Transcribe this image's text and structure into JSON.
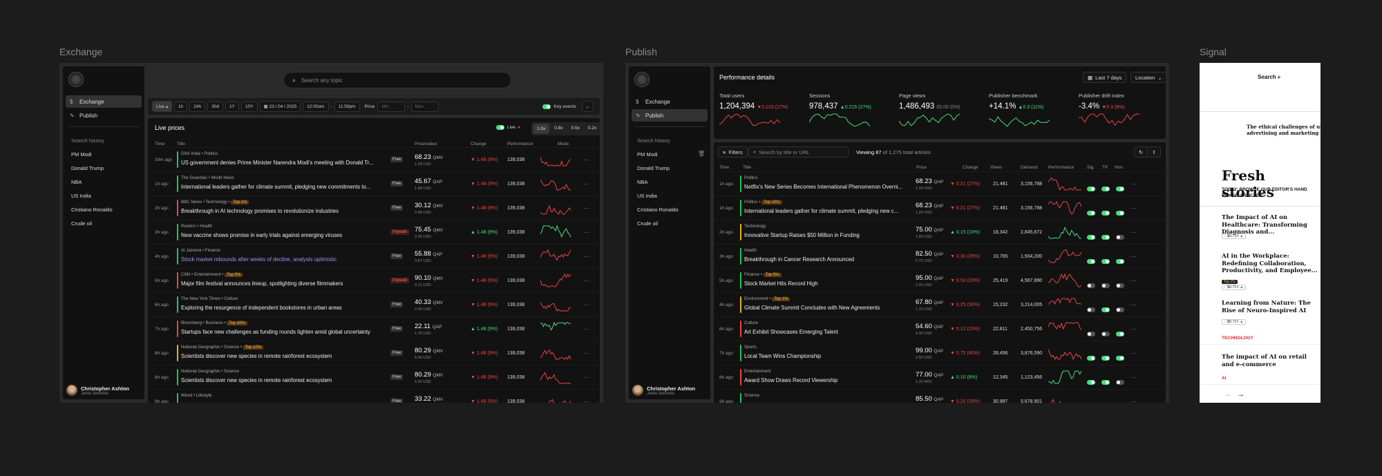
{
  "panels": {
    "exchange": "Exchange",
    "publish": "Publish",
    "signal": "Signal"
  },
  "sidebar": {
    "nav": [
      {
        "label": "Exchange",
        "icon": "dollar-icon"
      },
      {
        "label": "Publish",
        "icon": "pen-icon"
      }
    ],
    "history_title": "Search history",
    "history": [
      "PM Modi",
      "Donald Trump",
      "NBA",
      "US India",
      "Cristiano Ronaldo",
      "Crude oil"
    ],
    "user": {
      "name": "Christopher Ashton",
      "sub": "Janta Seriishta"
    }
  },
  "exchange": {
    "search_placeholder": "Search any topic",
    "toolbar": {
      "live": "Live",
      "ranges": [
        "1h",
        "24h",
        "30d",
        "1Y",
        "10Y"
      ],
      "date": "23 / 04 / 2025",
      "time_from": "12:00am",
      "time_to": "11:59pm",
      "price_label": "Price",
      "min_placeholder": "Min",
      "max_placeholder": "Max",
      "key_events": "Key events"
    },
    "title": "Live prices",
    "live_label": "Live",
    "speeds": [
      "1.0x",
      "0.8x",
      "0.5x",
      "0.2x"
    ],
    "columns": [
      "Time",
      "Title",
      "Price/value",
      "Change",
      "Performance",
      "Mode"
    ],
    "rows": [
      {
        "time": "30m ago",
        "source": "DNA India",
        "cat": "Politics",
        "tag": "",
        "title": "US government denies Prime Minister Narendra Modi's meeting with Donald Tr...",
        "badge": "Free",
        "price": "68.23",
        "unit": "QMV",
        "usd": "1.24 USD",
        "dir": "down",
        "change": "1.48 (9%)",
        "perf": "139,038",
        "bar": "#22c55e"
      },
      {
        "time": "1h ago",
        "source": "The Guardian",
        "cat": "World News",
        "tag": "",
        "title": "International leaders gather for climate summit, pledging new commitments to...",
        "badge": "Free",
        "price": "45.67",
        "unit": "QAP",
        "usd": "1.88 USD",
        "dir": "down",
        "change": "1.48 (9%)",
        "perf": "139,038",
        "bar": "#22c55e"
      },
      {
        "time": "2h ago",
        "source": "BBC News",
        "cat": "Technology",
        "tag": "Top 1%",
        "title": "Breakthrough in AI technology promises to revolutionize industries",
        "badge": "Free",
        "price": "30.12",
        "unit": "QMV",
        "usd": "0.89 USD",
        "dir": "down",
        "change": "1.48 (9%)",
        "perf": "139,038",
        "bar": "#ef4444"
      },
      {
        "time": "3h ago",
        "source": "Reuters",
        "cat": "Health",
        "tag": "",
        "title": "New vaccine shows promise in early trials against emerging viruses",
        "badge": "Paywall",
        "price": "75.45",
        "unit": "QMV",
        "usd": "2.34 USD",
        "dir": "up",
        "change": "1.48 (9%)",
        "perf": "139,038",
        "bar": "#22c55e"
      },
      {
        "time": "4h ago",
        "source": "Al Jazeera",
        "cat": "Finance",
        "tag": "",
        "title": "Stock market rebounds after weeks of decline, analysts optimistic",
        "badge": "Free",
        "price": "55.88",
        "unit": "QAP",
        "usd": "3.67 USD",
        "dir": "down",
        "change": "1.48 (9%)",
        "perf": "139,038",
        "bar": "#22c55e",
        "purple": true
      },
      {
        "time": "5h ago",
        "source": "CNN",
        "cat": "Entertainment",
        "tag": "Top 5%",
        "title": "Major film festival announces lineup, spotlighting diverse filmmakers",
        "badge": "Paywall",
        "price": "90.10",
        "unit": "QMV",
        "usd": "4.12 USD",
        "dir": "down",
        "change": "1.48 (9%)",
        "perf": "139,038",
        "bar": "#ef4444"
      },
      {
        "time": "6h ago",
        "source": "The New York Times",
        "cat": "Culture",
        "tag": "",
        "title": "Exploring the resurgence of independent bookstores in urban areas",
        "badge": "Free",
        "price": "40.33",
        "unit": "QMV",
        "usd": "2.45 USD",
        "dir": "down",
        "change": "1.48 (9%)",
        "perf": "139,038",
        "bar": "#22c55e"
      },
      {
        "time": "7h ago",
        "source": "Bloomberg",
        "cat": "Business",
        "tag": "Top 10%",
        "title": "Startups face new challenges as funding rounds tighten amid global uncertainty",
        "badge": "Free",
        "price": "22.11",
        "unit": "QAP",
        "usd": "1.78 USD",
        "dir": "up",
        "change": "1.48 (9%)",
        "perf": "139,038",
        "bar": "#ef4444"
      },
      {
        "time": "8h ago",
        "source": "National Geographic",
        "cat": "Science",
        "tag": "Top 10%",
        "title": "Scientists discover new species in remote rainforest ecosystem",
        "badge": "Free",
        "price": "80.29",
        "unit": "QMV",
        "usd": "5.69 USD",
        "dir": "down",
        "change": "1.48 (9%)",
        "perf": "139,038",
        "bar": "#eab308"
      },
      {
        "time": "8h ago",
        "source": "National Geographic",
        "cat": "Science",
        "tag": "",
        "title": "Scientists discover new species in remote rainforest ecosystem",
        "badge": "Free",
        "price": "80.29",
        "unit": "QMV",
        "usd": "5.69 USD",
        "dir": "down",
        "change": "1.48 (9%)",
        "perf": "139,038",
        "bar": "#22c55e"
      },
      {
        "time": "9h ago",
        "source": "Wired",
        "cat": "Lifestyle",
        "tag": "",
        "title": "",
        "badge": "Free",
        "price": "33.22",
        "unit": "QMV",
        "usd": "",
        "dir": "down",
        "change": "1.48 (9%)",
        "perf": "139,038",
        "bar": "#22c55e"
      }
    ]
  },
  "publish": {
    "title": "Performance details",
    "period": "Last 7 days",
    "location": "Location",
    "stats": [
      {
        "label": "Total users",
        "value": "1,204,394",
        "dir": "down",
        "delta": "0.215 (27%)"
      },
      {
        "label": "Sessions",
        "value": "978,437",
        "dir": "up",
        "delta": "0.215 (27%)"
      },
      {
        "label": "Page views",
        "value": "1,486,493",
        "dir": "flat",
        "delta": "00.00 (0%)"
      },
      {
        "label": "Publisher benchmark",
        "value": "+14.1%",
        "dir": "up",
        "delta": "0.3 (11%)"
      },
      {
        "label": "Publisher drift index",
        "value": "-3.4%",
        "dir": "down",
        "delta": "0.3 (8%)"
      }
    ],
    "filters": "Filters",
    "search_placeholder": "Search by title or URL",
    "viewing": "Viewing 87",
    "viewing_total": "of 1,275 total articles",
    "columns": [
      "Time",
      "Title",
      "Price",
      "Change",
      "Views",
      "Demand",
      "Performance",
      "Sig.",
      "TP",
      "Hov."
    ],
    "rows": [
      {
        "time": "1h ago",
        "cat": "Politics",
        "tag": "",
        "title": "Netflix's New Series Becomes International Phenomenon Overni...",
        "price": "68.23",
        "unit": "QAP",
        "usd": "1.24 USD",
        "dir": "down",
        "change": "0.21 (27%)",
        "views": "21,481",
        "demand": "3,156,788",
        "bar": "#22c55e",
        "toggles": [
          1,
          1,
          1
        ]
      },
      {
        "time": "1h ago",
        "cat": "Politics",
        "tag": "Top 10%",
        "title": "International leaders gather for climate summit, pledging new c...",
        "price": "68.23",
        "unit": "QAP",
        "usd": "1.24 USD",
        "dir": "down",
        "change": "0.21 (27%)",
        "views": "21,481",
        "demand": "3,156,788",
        "bar": "#22c55e",
        "toggles": [
          1,
          1,
          1
        ]
      },
      {
        "time": "2h ago",
        "cat": "Technology",
        "tag": "",
        "title": "Innovative Startup Raises $50 Million in Funding",
        "price": "75.00",
        "unit": "QAP",
        "usd": "1.50 USD",
        "dir": "up",
        "change": "0.15 (10%)",
        "views": "18,342",
        "demand": "2,845,672",
        "bar": "#eab308",
        "toggles": [
          1,
          1,
          0
        ]
      },
      {
        "time": "3h ago",
        "cat": "Health",
        "tag": "",
        "title": "Breakthrough in Cancer Research Announced",
        "price": "82.50",
        "unit": "QAP",
        "usd": "0.75 USD",
        "dir": "down",
        "change": "0.30 (35%)",
        "views": "10,765",
        "demand": "1,934,200",
        "bar": "#22c55e",
        "toggles": [
          1,
          1,
          1
        ]
      },
      {
        "time": "5h ago",
        "cat": "Finance",
        "tag": "Top 5%",
        "title": "Stock Market Hits Record High",
        "price": "95.00",
        "unit": "QAP",
        "usd": "2.00 USD",
        "dir": "down",
        "change": "0.50 (20%)",
        "views": "25,419",
        "demand": "4,567,890",
        "bar": "#22c55e",
        "toggles": [
          0,
          0,
          0
        ]
      },
      {
        "time": "4h ago",
        "cat": "Environment",
        "tag": "Top 1%",
        "title": "Global Climate Summit Concludes with New Agreements",
        "price": "67.80",
        "unit": "QAP",
        "usd": "1.10 USD",
        "dir": "down",
        "change": "0.25 (30%)",
        "views": "15,232",
        "demand": "3,214,005",
        "bar": "#eab308",
        "toggles": [
          0,
          1,
          0
        ]
      },
      {
        "time": "6h ago",
        "cat": "Culture",
        "tag": "",
        "title": "Art Exhibit Showcases Emerging Talent",
        "price": "54.60",
        "unit": "QAP",
        "usd": "0.90 USD",
        "dir": "down",
        "change": "0.12 (15%)",
        "views": "22,811",
        "demand": "2,450,756",
        "bar": "#ef4444",
        "toggles": [
          0,
          0,
          1
        ]
      },
      {
        "time": "7h ago",
        "cat": "Sports",
        "tag": "",
        "title": "Local Team Wins Championship",
        "price": "99.00",
        "unit": "QAP",
        "usd": "2.50 USD",
        "dir": "down",
        "change": "0.75 (40%)",
        "views": "28,456",
        "demand": "3,876,590",
        "bar": "#22c55e",
        "toggles": [
          1,
          1,
          1
        ]
      },
      {
        "time": "8h ago",
        "cat": "Entertainment",
        "tag": "",
        "title": "Award Show Draws Record Viewership",
        "price": "77.00",
        "unit": "QAP",
        "usd": "1.20 HKD",
        "dir": "up",
        "change": "0.10 (8%)",
        "views": "12,345",
        "demand": "1,123,456",
        "bar": "#ef4444",
        "toggles": [
          1,
          1,
          0
        ]
      },
      {
        "time": "9h ago",
        "cat": "Science",
        "tag": "",
        "title": "",
        "price": "85.50",
        "unit": "QAP",
        "usd": "",
        "dir": "down",
        "change": "0.20 (25%)",
        "views": "30,987",
        "demand": "5,678,901",
        "bar": "#22c55e",
        "toggles": [
          1,
          1,
          1
        ]
      }
    ]
  },
  "signal": {
    "search": "Search",
    "lead": "The ethical challenges of usi advertising and marketing",
    "heading": "Fresh stories",
    "subheading": "TODAY: BROWSE OUR EDITOR'S HAND PICKED ARTICLES!",
    "articles": [
      {
        "title": "The Impact of AI on Healthcare: Transforming Diagnosis and...",
        "price": "$0.71",
        "delta": "4 ▲",
        "topflag": ""
      },
      {
        "title": "AI in the Workplace: Redefining Collaboration, Productivity, and Employee...",
        "price": "$0.71",
        "delta": "4 ▲",
        "topflag": "Top 1%"
      },
      {
        "title": "Learning from Nature: The Rise of Neuro-Inspired AI",
        "price": "$0.71",
        "delta": "4 ▲",
        "topflag": ""
      }
    ],
    "category": "TECHNOLOGY",
    "last_title": "The impact of AI on retail and e-commerce",
    "last_cat": "AI"
  }
}
